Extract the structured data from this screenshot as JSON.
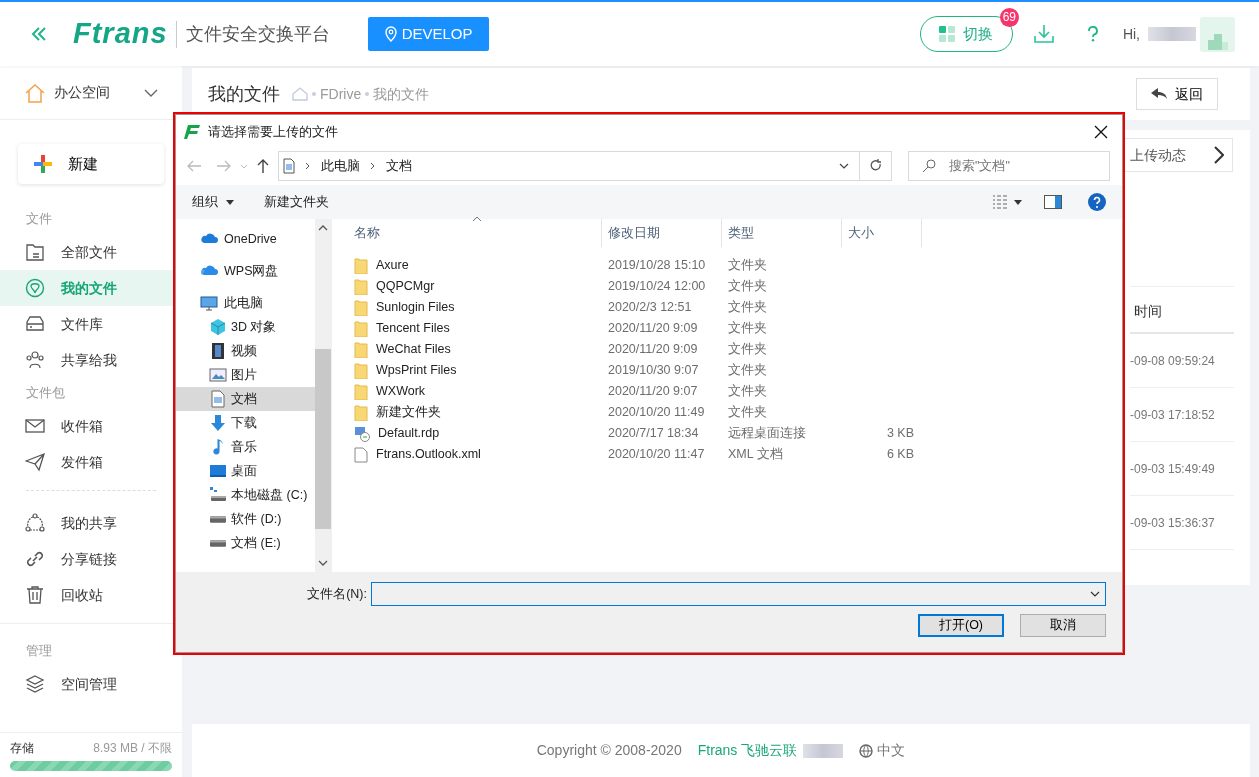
{
  "header": {
    "logo_text": "Ftrans",
    "title": "文件安全交换平台",
    "env_button": "DEVELOP",
    "switch_button": {
      "label": "切换",
      "badge": "69"
    },
    "greeting": "Hi,"
  },
  "sidebar": {
    "space": "办公空间",
    "new_button": "新建",
    "sections": [
      {
        "title": "文件",
        "items": [
          {
            "label": "全部文件",
            "selected": false
          },
          {
            "label": "我的文件",
            "selected": true
          },
          {
            "label": "文件库",
            "selected": false
          },
          {
            "label": "共享给我",
            "selected": false
          }
        ]
      },
      {
        "title": "文件包",
        "items": [
          {
            "label": "收件箱",
            "selected": false
          },
          {
            "label": "发件箱",
            "selected": false
          }
        ]
      },
      {
        "items": [
          {
            "label": "我的共享",
            "selected": false
          },
          {
            "label": "分享链接",
            "selected": false
          },
          {
            "label": "回收站",
            "selected": false
          }
        ]
      },
      {
        "title": "管理",
        "items": [
          {
            "label": "空间管理",
            "selected": false
          }
        ]
      }
    ],
    "storage": {
      "label": "存储",
      "reading": "8.93 MB / 不限",
      "level": 1
    }
  },
  "main": {
    "page_title": "我的文件",
    "breadcrumb": [
      "FDrive",
      "我的文件"
    ],
    "back_button": "返回",
    "upload_activity": "上传动态",
    "column_header": "时间",
    "times": [
      "-09-08 09:59:24",
      "-09-03 17:18:52",
      "-09-03 15:49:49",
      "-09-03 15:36:37"
    ]
  },
  "footer": {
    "copyright": "Copyright © 2008-2020",
    "brand": "Ftrans 飞驰云联",
    "language": "中文"
  },
  "dialog": {
    "title": "请选择需要上传的文件",
    "path": [
      "此电脑",
      "文档"
    ],
    "search": {
      "placeholder": "搜索\"文档\""
    },
    "toolbar": [
      "组织",
      "新建文件夹"
    ],
    "nav": [
      {
        "label": "OneDrive",
        "selected": false
      },
      {
        "label": "WPS网盘",
        "selected": false
      },
      {
        "label": "此电脑",
        "selected": false,
        "children": [
          {
            "label": "3D 对象",
            "selected": false
          },
          {
            "label": "视频",
            "selected": false
          },
          {
            "label": "图片",
            "selected": false
          },
          {
            "label": "文档",
            "selected": true
          },
          {
            "label": "下载",
            "selected": false
          },
          {
            "label": "音乐",
            "selected": false
          },
          {
            "label": "桌面",
            "selected": false
          },
          {
            "label": "本地磁盘 (C:)",
            "selected": false
          },
          {
            "label": "软件 (D:)",
            "selected": false
          },
          {
            "label": "文档 (E:)",
            "selected": false
          }
        ]
      }
    ],
    "columns": [
      "名称",
      "修改日期",
      "类型",
      "大小"
    ],
    "rows": [
      {
        "kind": "folder",
        "name": "Axure",
        "date": "2019/10/28 15:10",
        "type": "文件夹"
      },
      {
        "kind": "folder",
        "name": "QQPCMgr",
        "date": "2019/10/24 12:00",
        "type": "文件夹"
      },
      {
        "kind": "folder",
        "name": "Sunlogin Files",
        "date": "2020/2/3 12:51",
        "type": "文件夹"
      },
      {
        "kind": "folder",
        "name": "Tencent Files",
        "date": "2020/11/20 9:09",
        "type": "文件夹"
      },
      {
        "kind": "folder",
        "name": "WeChat Files",
        "date": "2020/11/20 9:09",
        "type": "文件夹"
      },
      {
        "kind": "folder",
        "name": "WpsPrint Files",
        "date": "2019/10/30 9:07",
        "type": "文件夹"
      },
      {
        "kind": "folder",
        "name": "WXWork",
        "date": "2020/11/20 9:07",
        "type": "文件夹"
      },
      {
        "kind": "folder",
        "name": "新建文件夹",
        "date": "2020/10/20 11:49",
        "type": "文件夹"
      },
      {
        "kind": "rdp",
        "name": "Default.rdp",
        "date": "2020/7/17 18:34",
        "type": "远程桌面连接",
        "size": "3 KB"
      },
      {
        "kind": "file",
        "name": "Ftrans.Outlook.xml",
        "date": "2020/10/20 11:47",
        "type": "XML 文档",
        "size": "6 KB"
      }
    ],
    "filename_label": "文件名(N):",
    "open_button": "打开(O)",
    "cancel_button": "取消"
  }
}
